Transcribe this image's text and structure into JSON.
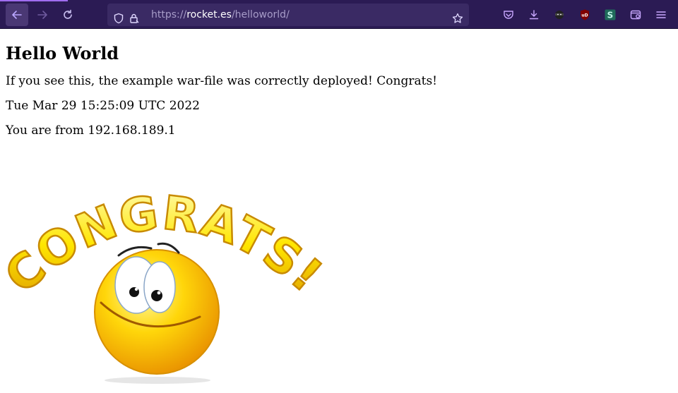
{
  "browser": {
    "url_scheme": "https://",
    "url_host": "rocket.es",
    "url_path": "/helloworld/"
  },
  "page": {
    "heading": "Hello World",
    "message": "If you see this, the example war-file was correctly deployed! Congrats!",
    "timestamp": "Tue Mar 29 15:25:09 UTC 2022",
    "origin": "You are from 192.168.189.1",
    "image_text": "CONGRATS!"
  },
  "colors": {
    "toolbar": "#2b1b54",
    "urlbar": "#3a2a64",
    "accent": "#a06df0",
    "congrats_yellow": "#ffe600"
  }
}
